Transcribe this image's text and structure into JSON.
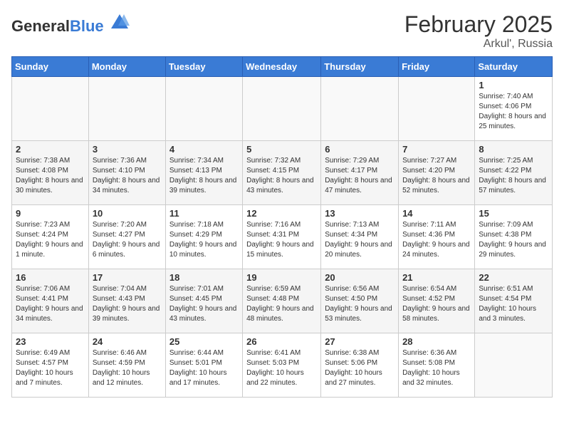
{
  "header": {
    "logo_general": "General",
    "logo_blue": "Blue",
    "title": "February 2025",
    "subtitle": "Arkul', Russia"
  },
  "days_of_week": [
    "Sunday",
    "Monday",
    "Tuesday",
    "Wednesday",
    "Thursday",
    "Friday",
    "Saturday"
  ],
  "weeks": [
    [
      {
        "day": "",
        "info": ""
      },
      {
        "day": "",
        "info": ""
      },
      {
        "day": "",
        "info": ""
      },
      {
        "day": "",
        "info": ""
      },
      {
        "day": "",
        "info": ""
      },
      {
        "day": "",
        "info": ""
      },
      {
        "day": "1",
        "info": "Sunrise: 7:40 AM\nSunset: 4:06 PM\nDaylight: 8 hours and 25 minutes."
      }
    ],
    [
      {
        "day": "2",
        "info": "Sunrise: 7:38 AM\nSunset: 4:08 PM\nDaylight: 8 hours and 30 minutes."
      },
      {
        "day": "3",
        "info": "Sunrise: 7:36 AM\nSunset: 4:10 PM\nDaylight: 8 hours and 34 minutes."
      },
      {
        "day": "4",
        "info": "Sunrise: 7:34 AM\nSunset: 4:13 PM\nDaylight: 8 hours and 39 minutes."
      },
      {
        "day": "5",
        "info": "Sunrise: 7:32 AM\nSunset: 4:15 PM\nDaylight: 8 hours and 43 minutes."
      },
      {
        "day": "6",
        "info": "Sunrise: 7:29 AM\nSunset: 4:17 PM\nDaylight: 8 hours and 47 minutes."
      },
      {
        "day": "7",
        "info": "Sunrise: 7:27 AM\nSunset: 4:20 PM\nDaylight: 8 hours and 52 minutes."
      },
      {
        "day": "8",
        "info": "Sunrise: 7:25 AM\nSunset: 4:22 PM\nDaylight: 8 hours and 57 minutes."
      }
    ],
    [
      {
        "day": "9",
        "info": "Sunrise: 7:23 AM\nSunset: 4:24 PM\nDaylight: 9 hours and 1 minute."
      },
      {
        "day": "10",
        "info": "Sunrise: 7:20 AM\nSunset: 4:27 PM\nDaylight: 9 hours and 6 minutes."
      },
      {
        "day": "11",
        "info": "Sunrise: 7:18 AM\nSunset: 4:29 PM\nDaylight: 9 hours and 10 minutes."
      },
      {
        "day": "12",
        "info": "Sunrise: 7:16 AM\nSunset: 4:31 PM\nDaylight: 9 hours and 15 minutes."
      },
      {
        "day": "13",
        "info": "Sunrise: 7:13 AM\nSunset: 4:34 PM\nDaylight: 9 hours and 20 minutes."
      },
      {
        "day": "14",
        "info": "Sunrise: 7:11 AM\nSunset: 4:36 PM\nDaylight: 9 hours and 24 minutes."
      },
      {
        "day": "15",
        "info": "Sunrise: 7:09 AM\nSunset: 4:38 PM\nDaylight: 9 hours and 29 minutes."
      }
    ],
    [
      {
        "day": "16",
        "info": "Sunrise: 7:06 AM\nSunset: 4:41 PM\nDaylight: 9 hours and 34 minutes."
      },
      {
        "day": "17",
        "info": "Sunrise: 7:04 AM\nSunset: 4:43 PM\nDaylight: 9 hours and 39 minutes."
      },
      {
        "day": "18",
        "info": "Sunrise: 7:01 AM\nSunset: 4:45 PM\nDaylight: 9 hours and 43 minutes."
      },
      {
        "day": "19",
        "info": "Sunrise: 6:59 AM\nSunset: 4:48 PM\nDaylight: 9 hours and 48 minutes."
      },
      {
        "day": "20",
        "info": "Sunrise: 6:56 AM\nSunset: 4:50 PM\nDaylight: 9 hours and 53 minutes."
      },
      {
        "day": "21",
        "info": "Sunrise: 6:54 AM\nSunset: 4:52 PM\nDaylight: 9 hours and 58 minutes."
      },
      {
        "day": "22",
        "info": "Sunrise: 6:51 AM\nSunset: 4:54 PM\nDaylight: 10 hours and 3 minutes."
      }
    ],
    [
      {
        "day": "23",
        "info": "Sunrise: 6:49 AM\nSunset: 4:57 PM\nDaylight: 10 hours and 7 minutes."
      },
      {
        "day": "24",
        "info": "Sunrise: 6:46 AM\nSunset: 4:59 PM\nDaylight: 10 hours and 12 minutes."
      },
      {
        "day": "25",
        "info": "Sunrise: 6:44 AM\nSunset: 5:01 PM\nDaylight: 10 hours and 17 minutes."
      },
      {
        "day": "26",
        "info": "Sunrise: 6:41 AM\nSunset: 5:03 PM\nDaylight: 10 hours and 22 minutes."
      },
      {
        "day": "27",
        "info": "Sunrise: 6:38 AM\nSunset: 5:06 PM\nDaylight: 10 hours and 27 minutes."
      },
      {
        "day": "28",
        "info": "Sunrise: 6:36 AM\nSunset: 5:08 PM\nDaylight: 10 hours and 32 minutes."
      },
      {
        "day": "",
        "info": ""
      }
    ]
  ]
}
